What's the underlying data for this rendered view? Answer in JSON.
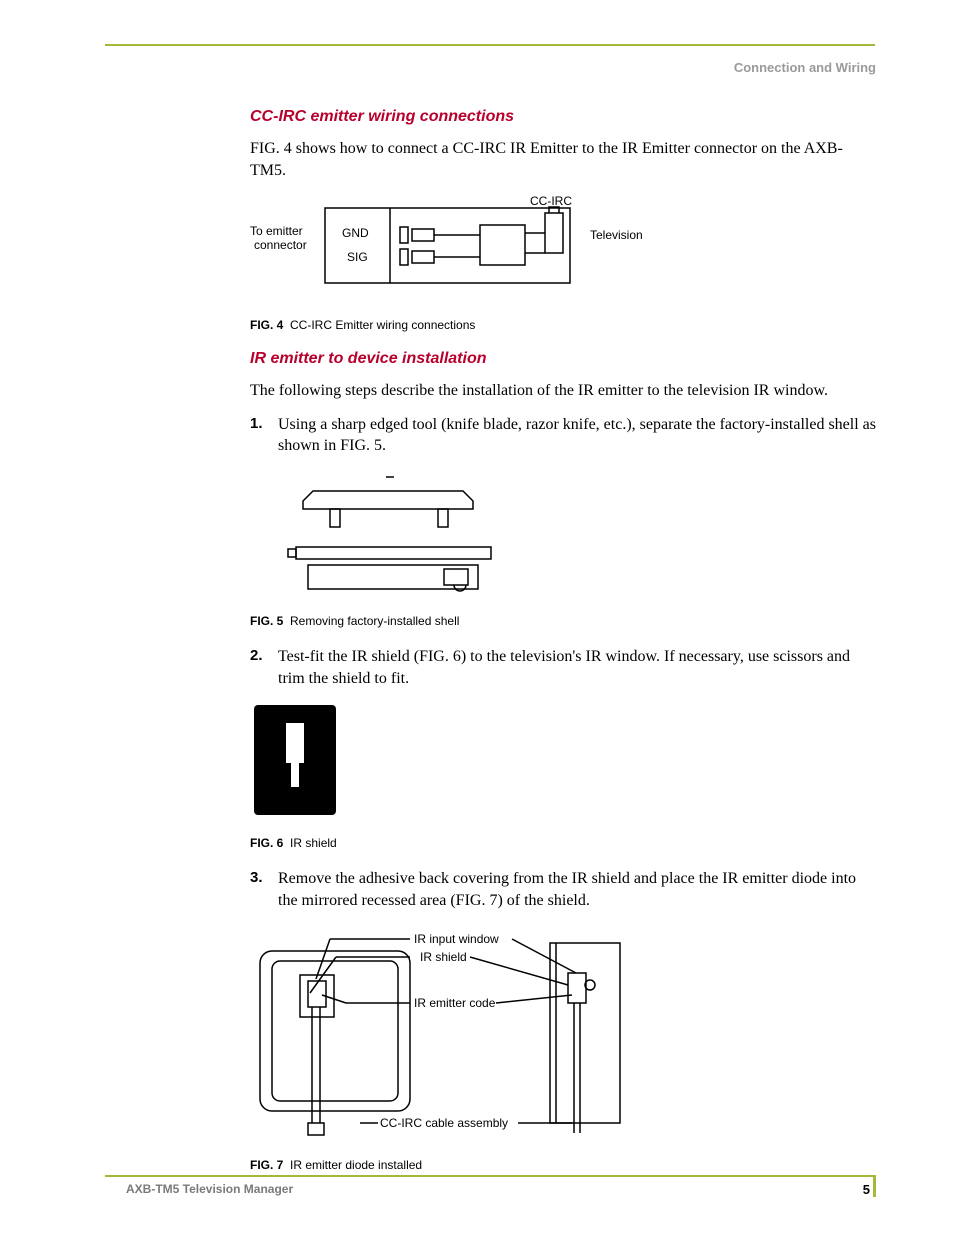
{
  "header": {
    "section": "Connection and Wiring"
  },
  "sections": {
    "s1": {
      "title": "CC-IRC emitter wiring connections",
      "p1": "FIG. 4 shows how to connect a CC-IRC IR Emitter to the IR Emitter connector on the AXB-TM5."
    },
    "s2": {
      "title": "IR emitter to device installation",
      "p1": "The following steps describe the installation of the IR emitter to the television IR window.",
      "steps": {
        "n1": "1.",
        "t1": "Using a sharp edged tool (knife blade, razor knife, etc.), separate the factory-installed shell as shown in FIG. 5.",
        "n2": "2.",
        "t2": "Test-fit the IR shield (FIG. 6) to the television's IR window. If necessary, use scissors and trim the shield to fit.",
        "n3": "3.",
        "t3": "Remove the adhesive back covering from the IR shield and place the IR emitter diode into the mirrored recessed area (FIG. 7) of the shield."
      }
    }
  },
  "figures": {
    "f4": {
      "label": "FIG. 4",
      "caption": "CC-IRC Emitter wiring connections",
      "labels": {
        "to_emitter": "To emitter",
        "connector": "connector",
        "gnd": "GND",
        "sig": "SIG",
        "ccirc": "CC-IRC",
        "tv": "Television"
      }
    },
    "f5": {
      "label": "FIG. 5",
      "caption": "Removing factory-installed shell"
    },
    "f6": {
      "label": "FIG. 6",
      "caption": "IR shield"
    },
    "f7": {
      "label": "FIG. 7",
      "caption": "IR emitter diode installed",
      "labels": {
        "ir_input": "IR input window",
        "ir_shield": "IR shield",
        "ir_emitter": "IR emitter code",
        "cable": "CC-IRC cable assembly"
      }
    }
  },
  "footer": {
    "doc_title": "AXB-TM5 Television Manager",
    "page_num": "5"
  }
}
